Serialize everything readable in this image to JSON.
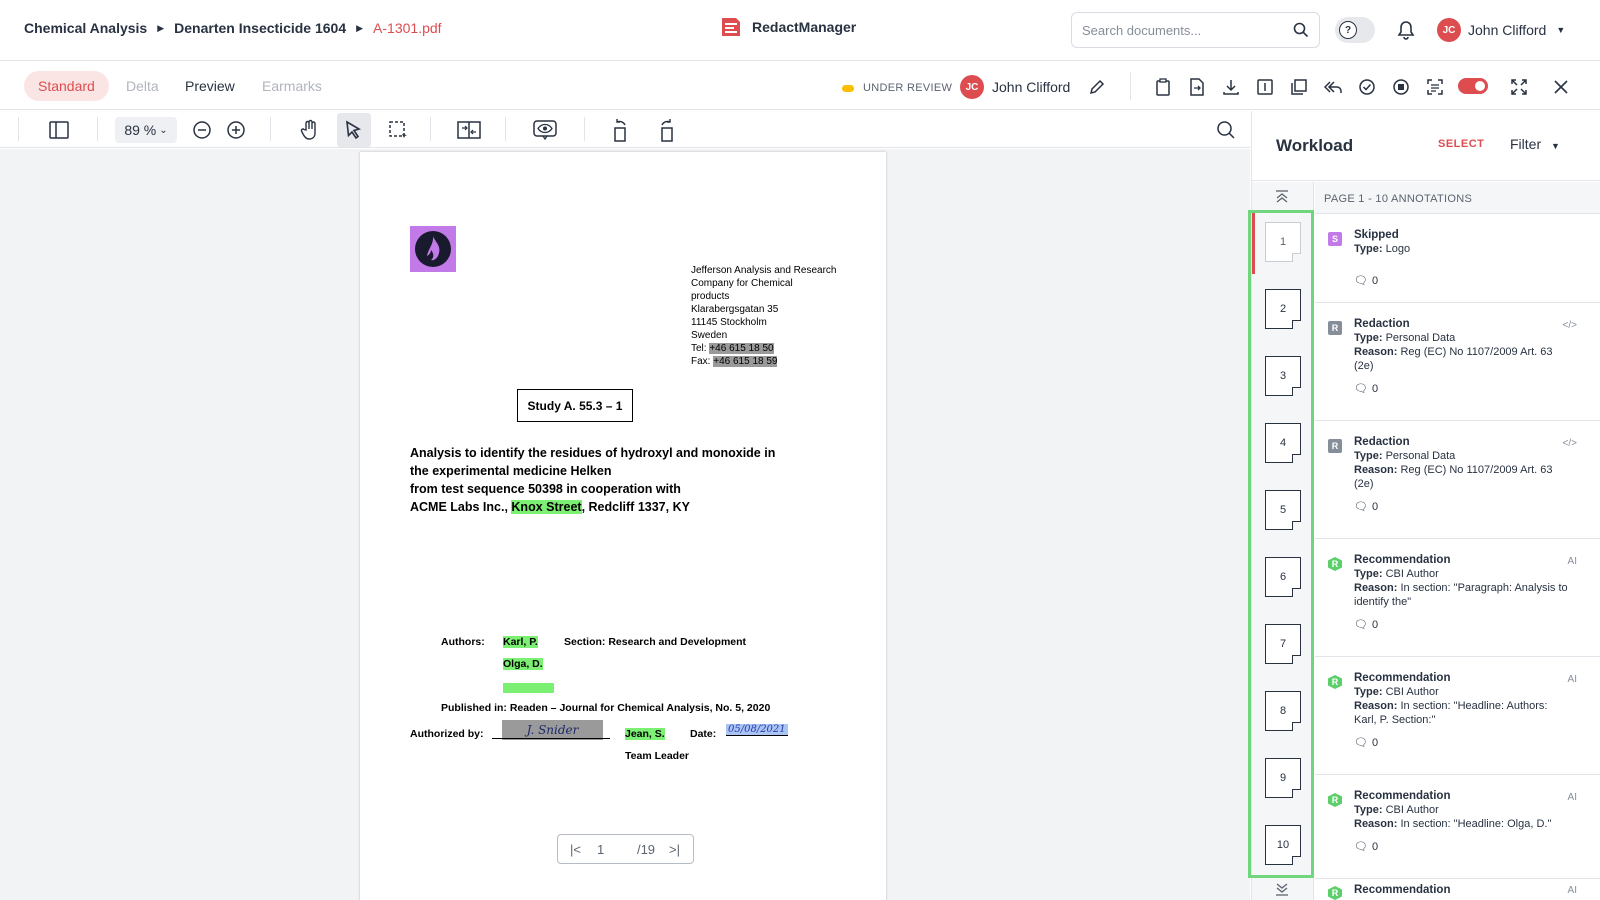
{
  "breadcrumbs": [
    "Chemical Analysis",
    "Denarten Insecticide 1604",
    "A-1301.pdf"
  ],
  "brand": "RedactManager",
  "search": {
    "placeholder": "Search documents..."
  },
  "help_toggle_label": "?",
  "user": {
    "initials": "JC",
    "name": "John Clifford"
  },
  "modes": [
    "Standard",
    "Delta",
    "Preview",
    "Earmarks"
  ],
  "status": "UNDER REVIEW",
  "assignee": {
    "initials": "JC",
    "name": "John Clifford"
  },
  "zoom": "89 %",
  "document": {
    "address_lines": [
      "Jefferson Analysis and Research",
      "Company for Chemical",
      "products",
      "Klarabergsgatan 35",
      "11145 Stockholm",
      "Sweden"
    ],
    "tel_label": "Tel:",
    "tel": "+46 615 18 50",
    "fax_label": "Fax:",
    "fax": "+46 615 18 59",
    "study": "Study A. 55.3 – 1",
    "analysis_lines": [
      "Analysis to identify the residues of hydroxyl and monoxide in",
      "the experimental medicine Helken",
      "from test sequence 50398 in cooperation with"
    ],
    "acme_pre": "ACME Labs Inc., ",
    "acme_street": "Knox Street",
    "acme_post": ", Redcliff 1337, KY",
    "authors_label": "Authors:",
    "author1": "Karl, P.",
    "author2": "Olga, D.",
    "section": "Section: Research and Development",
    "published": "Published in: Readen – Journal for Chemical Analysis, No. 5, 2020",
    "authorized_label": "Authorized by:",
    "signature": "J. Snider",
    "authorizer": "Jean, S.",
    "date_label": "Date:",
    "date_value": "05/08/2021",
    "role": "Team Leader"
  },
  "pager": {
    "current": "1",
    "total": "/19"
  },
  "panel": {
    "title": "Workload",
    "select": "SELECT",
    "filter": "Filter",
    "list_header": "PAGE 1 - 10 ANNOTATIONS",
    "pages": [
      "1",
      "2",
      "3",
      "4",
      "5",
      "6",
      "7",
      "8",
      "9",
      "10"
    ],
    "annotations": [
      {
        "badge": "S",
        "title": "Skipped",
        "type_label": "Type:",
        "type": "Logo",
        "reason_label": "",
        "reason": "",
        "comments": "0",
        "tag": ""
      },
      {
        "badge": "R",
        "title": "Redaction",
        "type_label": "Type:",
        "type": "Personal Data",
        "reason_label": "Reason:",
        "reason": "Reg (EC) No 1107/2009 Art. 63 (2e)",
        "comments": "0",
        "tag": "</>"
      },
      {
        "badge": "R",
        "title": "Redaction",
        "type_label": "Type:",
        "type": "Personal Data",
        "reason_label": "Reason:",
        "reason": "Reg (EC) No 1107/2009 Art. 63 (2e)",
        "comments": "0",
        "tag": "</>"
      },
      {
        "badge": "R",
        "title": "Recommendation",
        "type_label": "Type:",
        "type": "CBI Author",
        "reason_label": "Reason:",
        "reason": "In section: \"Paragraph: Analysis to identify the\"",
        "comments": "0",
        "tag": "AI"
      },
      {
        "badge": "R",
        "title": "Recommendation",
        "type_label": "Type:",
        "type": "CBI Author",
        "reason_label": "Reason:",
        "reason": "In section: \"Headline: Authors: Karl, P. Section:\"",
        "comments": "0",
        "tag": "AI"
      },
      {
        "badge": "R",
        "title": "Recommendation",
        "type_label": "Type:",
        "type": "CBI Author",
        "reason_label": "Reason:",
        "reason": "In section: \"Headline: Olga, D.\"",
        "comments": "0",
        "tag": "AI"
      },
      {
        "badge": "R",
        "title": "Recommendation",
        "type_label": "",
        "type": "",
        "reason_label": "",
        "reason": "",
        "comments": "",
        "tag": "AI"
      }
    ]
  },
  "colors": {
    "accent": "#dd4d50",
    "highlight_green": "#7cf072",
    "redaction_grey": "#9a9a9a",
    "skipped_purple": "#c17ae8",
    "status_yellow": "#fdbd00"
  }
}
